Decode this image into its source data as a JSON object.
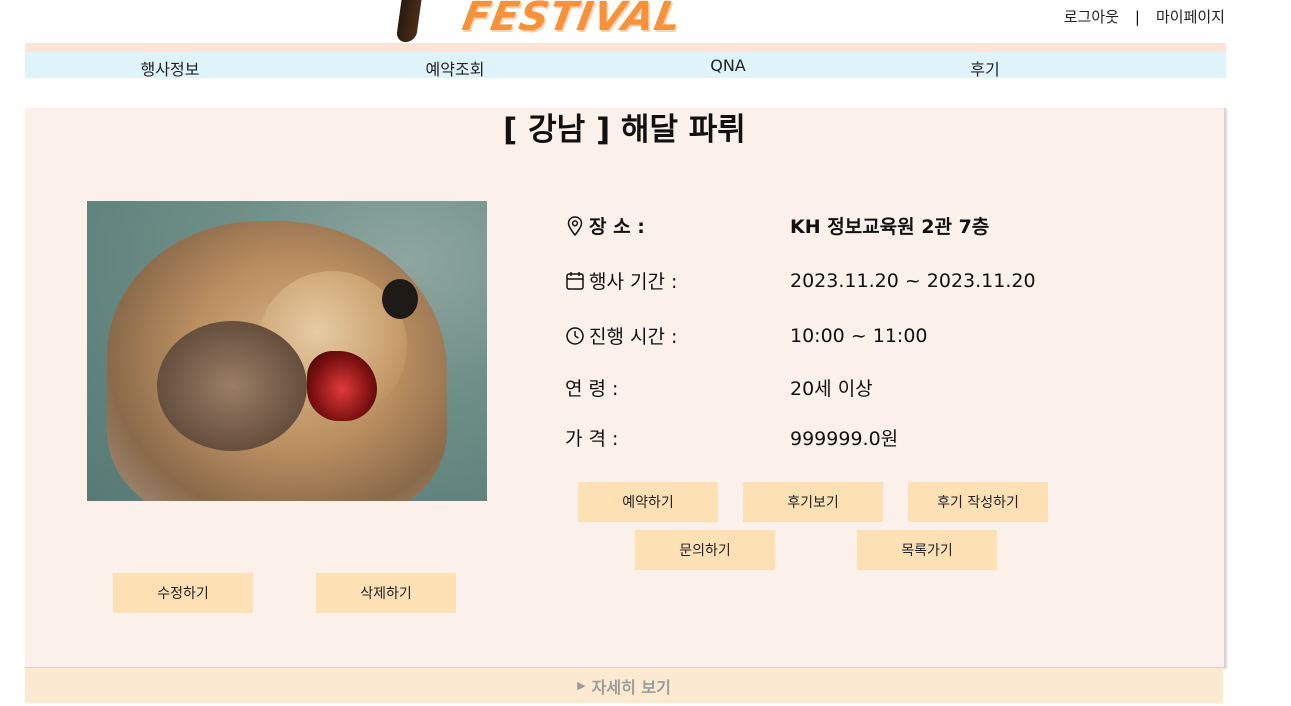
{
  "header": {
    "logo_text": "FESTIVAL",
    "logout_link": "로그아웃",
    "separator": "|",
    "mypage_link": "마이페이지"
  },
  "nav": {
    "items": [
      "행사정보",
      "예약조회",
      "QNA",
      "후기"
    ]
  },
  "event": {
    "title": "[ 강남 ] 해달 파뤼",
    "image_alt": "otter",
    "place_label": "장 소 :",
    "place_value": "KH 정보교육원 2관 7층",
    "period_label": "행사 기간 :",
    "period_value": "2023.11.20 ~ 2023.11.20",
    "time_label": "진행 시간 :",
    "time_value": "10:00 ~ 11:00",
    "age_label": "연 령 :",
    "age_value": "20세 이상",
    "price_label": "가 격 :",
    "price_value": "999999.0원"
  },
  "buttons": {
    "reserve": "예약하기",
    "view_reviews": "후기보기",
    "write_review": "후기 작성하기",
    "inquiry": "문의하기",
    "to_list": "목록가기",
    "edit": "수정하기",
    "delete": "삭제하기"
  },
  "details_toggle": {
    "arrow": "▶",
    "label": "자세히 보기"
  },
  "colors": {
    "nav_bg": "#dff3fb",
    "panel_bg": "#fcf1ea",
    "button_bg": "#fde1b5",
    "logo": "#f7923a",
    "details_bg": "#fbe9d2"
  },
  "icons": [
    "map-pin-icon",
    "calendar-icon",
    "clock-icon",
    "triangle-right-icon"
  ]
}
